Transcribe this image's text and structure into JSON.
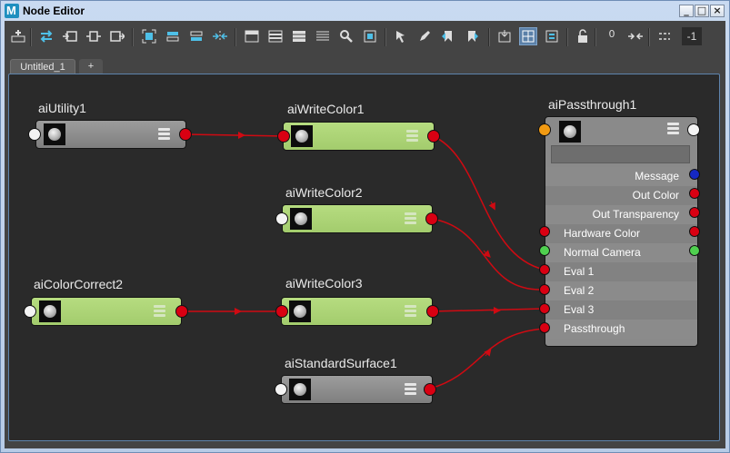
{
  "window": {
    "title": "Node Editor",
    "buttons": [
      "_",
      "□",
      "×"
    ]
  },
  "toolbar": {
    "icons": [
      "add-node-icon",
      "swap-icon",
      "input-connections-icon",
      "input-output-connections-icon",
      "output-connections-icon",
      "frame-all-icon",
      "frame-selected-icon",
      "frame-node-icon",
      "layout-icon",
      "simple-mode-icon",
      "connected-mode-icon",
      "full-mode-icon",
      "custom-mode-icon",
      "search-icon",
      "graph-icon",
      "pin-icon",
      "pen-icon",
      "bookmark-prev-icon",
      "bookmark-next-icon",
      "snap-icon",
      "grid-toggle-icon",
      "attribute-filter-icon",
      "lock-icon",
      "port-zero-icon",
      "port-add-icon"
    ],
    "active_icon": "grid-toggle-icon",
    "zero_label": "0",
    "field_value": "-1"
  },
  "tabs": [
    "Untitled_1",
    "+"
  ],
  "nodes": {
    "aiUtility1": {
      "title": "aiUtility1"
    },
    "aiWriteColor1": {
      "title": "aiWriteColor1"
    },
    "aiWriteColor2": {
      "title": "aiWriteColor2"
    },
    "aiColorCorrect2": {
      "title": "aiColorCorrect2"
    },
    "aiWriteColor3": {
      "title": "aiWriteColor3"
    },
    "aiStandardSurface1": {
      "title": "aiStandardSurface1"
    }
  },
  "passthrough": {
    "title": "aiPassthrough1",
    "attributes": [
      {
        "label": "Message",
        "side": "out",
        "port": "blue"
      },
      {
        "label": "Out Color",
        "side": "out",
        "port": "red"
      },
      {
        "label": "Out Transparency",
        "side": "out",
        "port": "red"
      },
      {
        "label": "Hardware Color",
        "side": "both",
        "port": "red"
      },
      {
        "label": "Normal Camera",
        "side": "both",
        "port": "green"
      },
      {
        "label": "Eval 1",
        "side": "in",
        "port": "red"
      },
      {
        "label": "Eval 2",
        "side": "in",
        "port": "red"
      },
      {
        "label": "Eval 3",
        "side": "in",
        "port": "red"
      },
      {
        "label": "Passthrough",
        "side": "in",
        "port": "red"
      }
    ]
  },
  "colors": {
    "connection": "#d00a12",
    "node_gray": "#8a8a8a",
    "node_green": "#a9d174",
    "graph_bg": "#2a2a2a",
    "accent": "#5b80a8"
  }
}
